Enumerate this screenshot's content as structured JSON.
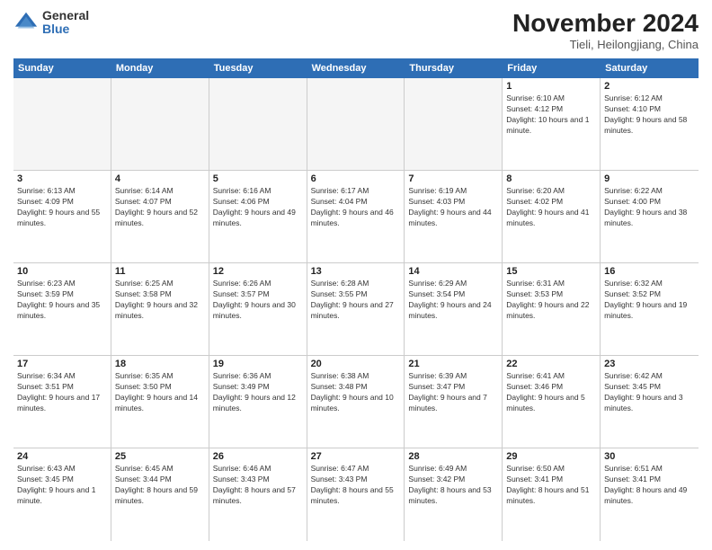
{
  "logo": {
    "general": "General",
    "blue": "Blue"
  },
  "header": {
    "month": "November 2024",
    "location": "Tieli, Heilongjiang, China"
  },
  "weekdays": [
    "Sunday",
    "Monday",
    "Tuesday",
    "Wednesday",
    "Thursday",
    "Friday",
    "Saturday"
  ],
  "weeks": [
    [
      {
        "day": "",
        "empty": true
      },
      {
        "day": "",
        "empty": true
      },
      {
        "day": "",
        "empty": true
      },
      {
        "day": "",
        "empty": true
      },
      {
        "day": "",
        "empty": true
      },
      {
        "day": "1",
        "sunrise": "Sunrise: 6:10 AM",
        "sunset": "Sunset: 4:12 PM",
        "daylight": "Daylight: 10 hours and 1 minute."
      },
      {
        "day": "2",
        "sunrise": "Sunrise: 6:12 AM",
        "sunset": "Sunset: 4:10 PM",
        "daylight": "Daylight: 9 hours and 58 minutes."
      }
    ],
    [
      {
        "day": "3",
        "sunrise": "Sunrise: 6:13 AM",
        "sunset": "Sunset: 4:09 PM",
        "daylight": "Daylight: 9 hours and 55 minutes."
      },
      {
        "day": "4",
        "sunrise": "Sunrise: 6:14 AM",
        "sunset": "Sunset: 4:07 PM",
        "daylight": "Daylight: 9 hours and 52 minutes."
      },
      {
        "day": "5",
        "sunrise": "Sunrise: 6:16 AM",
        "sunset": "Sunset: 4:06 PM",
        "daylight": "Daylight: 9 hours and 49 minutes."
      },
      {
        "day": "6",
        "sunrise": "Sunrise: 6:17 AM",
        "sunset": "Sunset: 4:04 PM",
        "daylight": "Daylight: 9 hours and 46 minutes."
      },
      {
        "day": "7",
        "sunrise": "Sunrise: 6:19 AM",
        "sunset": "Sunset: 4:03 PM",
        "daylight": "Daylight: 9 hours and 44 minutes."
      },
      {
        "day": "8",
        "sunrise": "Sunrise: 6:20 AM",
        "sunset": "Sunset: 4:02 PM",
        "daylight": "Daylight: 9 hours and 41 minutes."
      },
      {
        "day": "9",
        "sunrise": "Sunrise: 6:22 AM",
        "sunset": "Sunset: 4:00 PM",
        "daylight": "Daylight: 9 hours and 38 minutes."
      }
    ],
    [
      {
        "day": "10",
        "sunrise": "Sunrise: 6:23 AM",
        "sunset": "Sunset: 3:59 PM",
        "daylight": "Daylight: 9 hours and 35 minutes."
      },
      {
        "day": "11",
        "sunrise": "Sunrise: 6:25 AM",
        "sunset": "Sunset: 3:58 PM",
        "daylight": "Daylight: 9 hours and 32 minutes."
      },
      {
        "day": "12",
        "sunrise": "Sunrise: 6:26 AM",
        "sunset": "Sunset: 3:57 PM",
        "daylight": "Daylight: 9 hours and 30 minutes."
      },
      {
        "day": "13",
        "sunrise": "Sunrise: 6:28 AM",
        "sunset": "Sunset: 3:55 PM",
        "daylight": "Daylight: 9 hours and 27 minutes."
      },
      {
        "day": "14",
        "sunrise": "Sunrise: 6:29 AM",
        "sunset": "Sunset: 3:54 PM",
        "daylight": "Daylight: 9 hours and 24 minutes."
      },
      {
        "day": "15",
        "sunrise": "Sunrise: 6:31 AM",
        "sunset": "Sunset: 3:53 PM",
        "daylight": "Daylight: 9 hours and 22 minutes."
      },
      {
        "day": "16",
        "sunrise": "Sunrise: 6:32 AM",
        "sunset": "Sunset: 3:52 PM",
        "daylight": "Daylight: 9 hours and 19 minutes."
      }
    ],
    [
      {
        "day": "17",
        "sunrise": "Sunrise: 6:34 AM",
        "sunset": "Sunset: 3:51 PM",
        "daylight": "Daylight: 9 hours and 17 minutes."
      },
      {
        "day": "18",
        "sunrise": "Sunrise: 6:35 AM",
        "sunset": "Sunset: 3:50 PM",
        "daylight": "Daylight: 9 hours and 14 minutes."
      },
      {
        "day": "19",
        "sunrise": "Sunrise: 6:36 AM",
        "sunset": "Sunset: 3:49 PM",
        "daylight": "Daylight: 9 hours and 12 minutes."
      },
      {
        "day": "20",
        "sunrise": "Sunrise: 6:38 AM",
        "sunset": "Sunset: 3:48 PM",
        "daylight": "Daylight: 9 hours and 10 minutes."
      },
      {
        "day": "21",
        "sunrise": "Sunrise: 6:39 AM",
        "sunset": "Sunset: 3:47 PM",
        "daylight": "Daylight: 9 hours and 7 minutes."
      },
      {
        "day": "22",
        "sunrise": "Sunrise: 6:41 AM",
        "sunset": "Sunset: 3:46 PM",
        "daylight": "Daylight: 9 hours and 5 minutes."
      },
      {
        "day": "23",
        "sunrise": "Sunrise: 6:42 AM",
        "sunset": "Sunset: 3:45 PM",
        "daylight": "Daylight: 9 hours and 3 minutes."
      }
    ],
    [
      {
        "day": "24",
        "sunrise": "Sunrise: 6:43 AM",
        "sunset": "Sunset: 3:45 PM",
        "daylight": "Daylight: 9 hours and 1 minute."
      },
      {
        "day": "25",
        "sunrise": "Sunrise: 6:45 AM",
        "sunset": "Sunset: 3:44 PM",
        "daylight": "Daylight: 8 hours and 59 minutes."
      },
      {
        "day": "26",
        "sunrise": "Sunrise: 6:46 AM",
        "sunset": "Sunset: 3:43 PM",
        "daylight": "Daylight: 8 hours and 57 minutes."
      },
      {
        "day": "27",
        "sunrise": "Sunrise: 6:47 AM",
        "sunset": "Sunset: 3:43 PM",
        "daylight": "Daylight: 8 hours and 55 minutes."
      },
      {
        "day": "28",
        "sunrise": "Sunrise: 6:49 AM",
        "sunset": "Sunset: 3:42 PM",
        "daylight": "Daylight: 8 hours and 53 minutes."
      },
      {
        "day": "29",
        "sunrise": "Sunrise: 6:50 AM",
        "sunset": "Sunset: 3:41 PM",
        "daylight": "Daylight: 8 hours and 51 minutes."
      },
      {
        "day": "30",
        "sunrise": "Sunrise: 6:51 AM",
        "sunset": "Sunset: 3:41 PM",
        "daylight": "Daylight: 8 hours and 49 minutes."
      }
    ]
  ]
}
